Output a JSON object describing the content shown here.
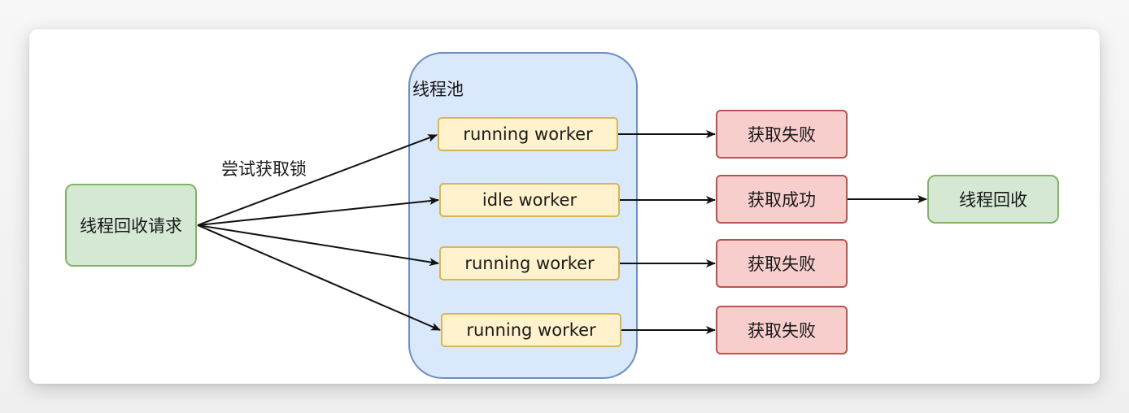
{
  "diagram": {
    "request_node": "线程回收请求",
    "edge_label": "尝试获取锁",
    "pool_title": "线程池",
    "workers": [
      "running worker",
      "idle worker",
      "running worker",
      "running worker"
    ],
    "results": [
      "获取失败",
      "获取成功",
      "获取失败",
      "获取失败"
    ],
    "final_node": "线程回收"
  },
  "colors": {
    "green_fill": "#d5e8d4",
    "green_stroke": "#82b366",
    "red_fill": "#f8cecc",
    "red_stroke": "#b85450",
    "yellow_fill": "#fff2cc",
    "yellow_stroke": "#d6b656",
    "pool_fill": "#dae8fc",
    "pool_stroke": "#6c8ebf"
  }
}
